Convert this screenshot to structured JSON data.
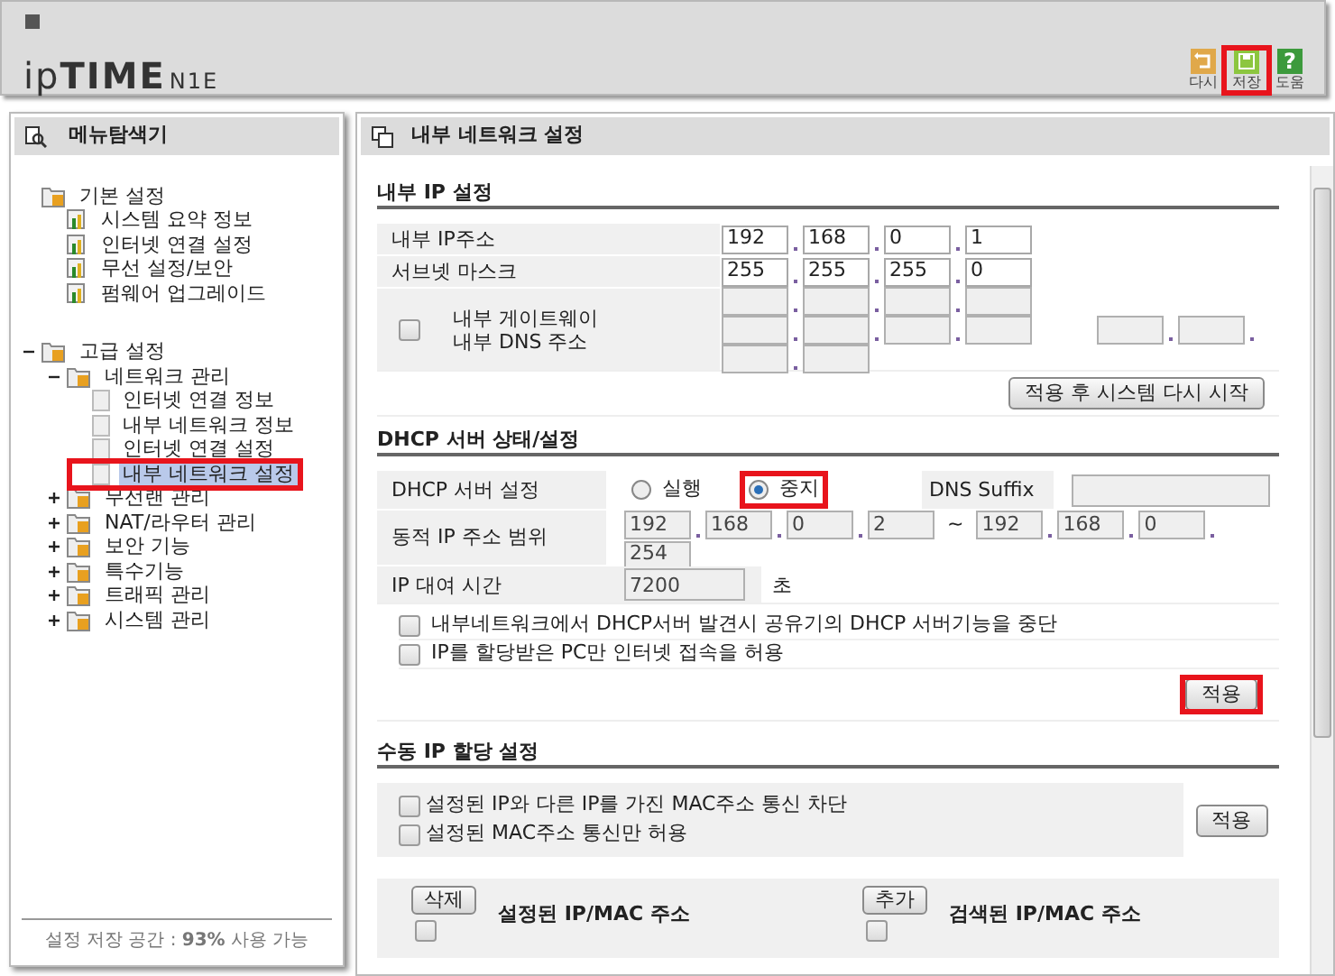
{
  "header": {
    "logo": "ip**TIME**",
    "model": "N1E",
    "toolbar": [
      {
        "kind": "undo",
        "label": "다시",
        "highlighted": false
      },
      {
        "kind": "save",
        "label": "저장",
        "highlighted": true
      },
      {
        "kind": "help",
        "glyph": "?",
        "label": "도움",
        "highlighted": false
      }
    ]
  },
  "sidebar": {
    "title": "메뉴탐색기",
    "tree": [
      {
        "label": "기본 설정",
        "kind": "folder",
        "children": [
          {
            "label": "시스템 요약 정보",
            "kind": "app"
          },
          {
            "label": "인터넷 연결 설정",
            "kind": "app"
          },
          {
            "label": "무선 설정/보안",
            "kind": "app"
          },
          {
            "label": "펌웨어 업그레이드",
            "kind": "app"
          }
        ]
      },
      {
        "label": "고급 설정",
        "kind": "folder",
        "expanded": true,
        "children": [
          {
            "label": "네트워크 관리",
            "kind": "folder",
            "expanded": true,
            "children": [
              {
                "label": "인터넷 연결 정보",
                "kind": "page",
                "selected": false,
                "highlighted": false
              },
              {
                "label": "내부 네트워크 정보",
                "kind": "page",
                "selected": false,
                "highlighted": false
              },
              {
                "label": "인터넷 연결 설정",
                "kind": "page",
                "selected": false,
                "highlighted": false
              },
              {
                "label": "내부 네트워크 설정",
                "kind": "page",
                "selected": true,
                "highlighted": true
              }
            ]
          },
          {
            "label": "무선랜 관리",
            "kind": "folder",
            "expanded": false
          },
          {
            "label": "NAT/라우터 관리",
            "kind": "folder",
            "expanded": false
          },
          {
            "label": "보안 기능",
            "kind": "folder",
            "expanded": false
          },
          {
            "label": "특수기능",
            "kind": "folder",
            "expanded": false
          },
          {
            "label": "트래픽 관리",
            "kind": "folder",
            "expanded": false
          },
          {
            "label": "시스템 관리",
            "kind": "folder",
            "expanded": false
          }
        ]
      }
    ],
    "footer": "설정 저장 공간 : **93%** 사용 가능"
  },
  "main": {
    "title": "내부 네트워크 설정",
    "internal_ip": {
      "title": "내부 IP 설정",
      "rows": [
        {
          "label": "내부 IP주소",
          "octets": [
            "192",
            "168",
            "0",
            "1"
          ]
        },
        {
          "label": "서브넷 마스크",
          "octets": [
            "255",
            "255",
            "255",
            "0"
          ]
        }
      ],
      "gateway_dns": {
        "checked": false,
        "labels": [
          "내부 게이트웨이",
          "내부 DNS 주소"
        ],
        "disabled": true
      },
      "button": {
        "label": "적용 후 시스템 다시 시작",
        "highlighted": false
      }
    },
    "dhcp": {
      "title": "DHCP 서버 상태/설정",
      "server_label": "DHCP 서버 설정",
      "options": [
        {
          "label": "실행",
          "selected": false,
          "highlighted": false
        },
        {
          "label": "중지",
          "selected": true,
          "highlighted": true
        }
      ],
      "dns_suffix_label": "DNS Suffix",
      "range_label": "동적 IP 주소 범위",
      "range_start": [
        "192",
        "168",
        "0",
        "2"
      ],
      "range_separator": "~",
      "range_end": [
        "192",
        "168",
        "0",
        "254"
      ],
      "lease_label": "IP 대여 시간",
      "lease": "7200",
      "lease_unit": "초",
      "disabled": true,
      "options_checks": [
        {
          "label": "내부네트워크에서 DHCP서버 발견시 공유기의 DHCP 서버기능을 중단",
          "checked": false
        },
        {
          "label": "IP를 할당받은 PC만 인터넷 접속을 허용",
          "checked": false
        }
      ],
      "button": {
        "label": "적용",
        "highlighted": true
      }
    },
    "manual": {
      "title": "수동 IP 할당 설정",
      "checks": [
        {
          "label": "설정된 IP와 다른 IP를 가진 MAC주소 통신 차단",
          "checked": false
        },
        {
          "label": "설정된 MAC주소 통신만 허용",
          "checked": false
        }
      ],
      "button": {
        "label": "적용",
        "highlighted": false
      },
      "columns": [
        {
          "button": "삭제",
          "title": "설정된 IP/MAC 주소",
          "checked": false
        },
        {
          "button": "추가",
          "title": "검색된 IP/MAC 주소",
          "checked": false
        }
      ]
    }
  }
}
